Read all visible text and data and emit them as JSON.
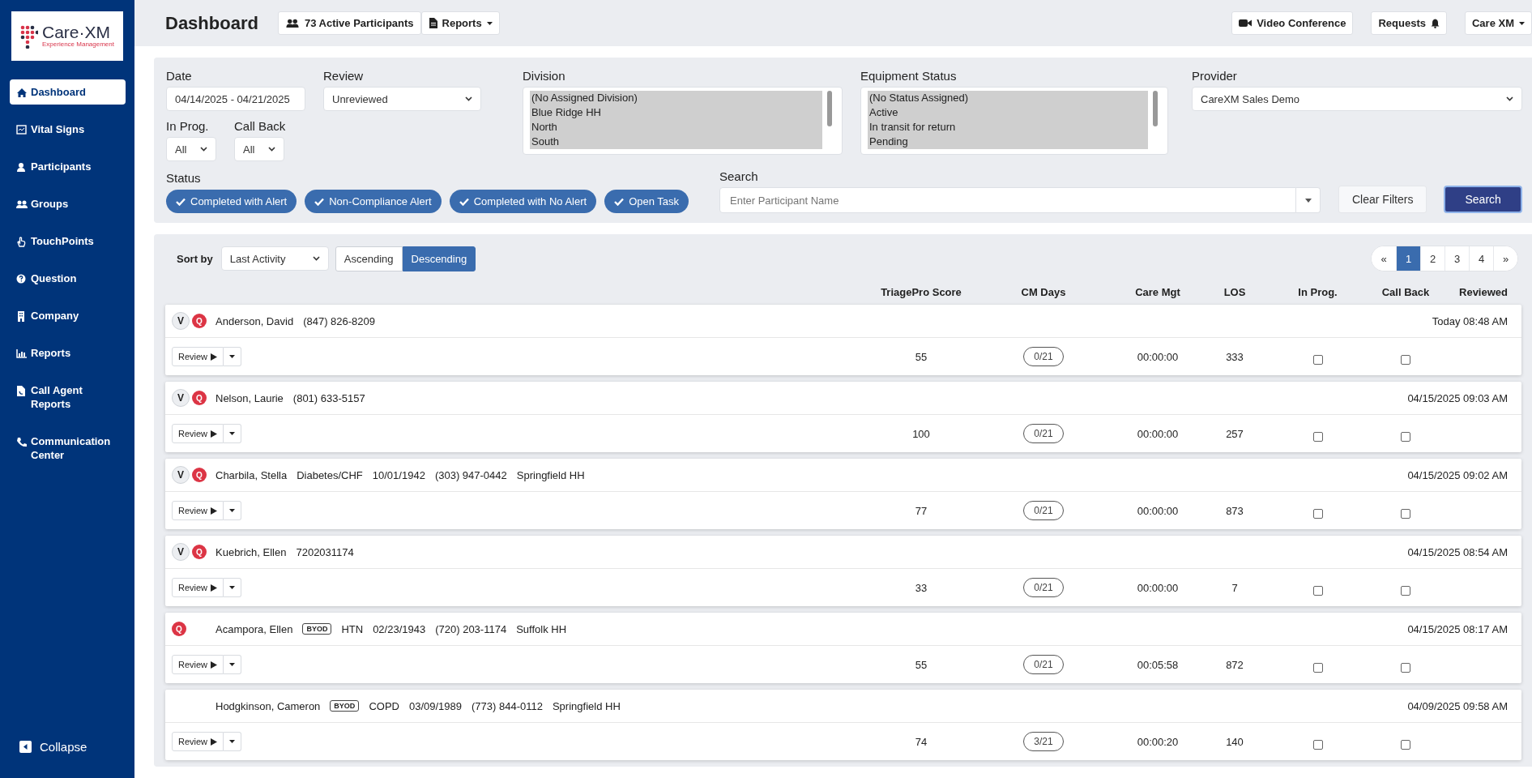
{
  "logo": {
    "brand": "Care·XM",
    "tagline": "Experience Management"
  },
  "sidebar": {
    "items": [
      {
        "label": "Dashboard",
        "selected": true
      },
      {
        "label": "Vital Signs",
        "selected": false
      },
      {
        "label": "Participants",
        "selected": false
      },
      {
        "label": "Groups",
        "selected": false
      },
      {
        "label": "TouchPoints",
        "selected": false
      },
      {
        "label": "Question",
        "selected": false
      },
      {
        "label": "Company",
        "selected": false
      },
      {
        "label": "Reports",
        "selected": false
      },
      {
        "label": "Call Agent Reports",
        "selected": false
      },
      {
        "label": "Communication Center",
        "selected": false
      }
    ],
    "collapse": "Collapse"
  },
  "header": {
    "title": "Dashboard",
    "participants_button": "73 Active Participants",
    "reports_button": "Reports",
    "video_button": "Video Conference",
    "requests_button": "Requests",
    "account_button": "Care XM"
  },
  "filters": {
    "date": {
      "label": "Date",
      "value": "04/14/2025 - 04/21/2025"
    },
    "review": {
      "label": "Review",
      "value": "Unreviewed"
    },
    "in_prog": {
      "label": "In Prog.",
      "value": "All"
    },
    "call_back": {
      "label": "Call Back",
      "value": "All"
    },
    "division": {
      "label": "Division",
      "options": [
        {
          "label": "(No Assigned Division)",
          "selected": true
        },
        {
          "label": "Blue Ridge HH",
          "selected": true
        },
        {
          "label": "North",
          "selected": true
        },
        {
          "label": "South",
          "selected": true
        }
      ]
    },
    "equipment_status": {
      "label": "Equipment Status",
      "options": [
        {
          "label": "(No Status Assigned)",
          "selected": true
        },
        {
          "label": "Active",
          "selected": true
        },
        {
          "label": "In transit for return",
          "selected": true
        },
        {
          "label": "Pending",
          "selected": true
        }
      ]
    },
    "provider": {
      "label": "Provider",
      "value": "CareXM Sales Demo"
    },
    "status": {
      "label": "Status",
      "chips": [
        {
          "label": "Completed with Alert",
          "checked": true
        },
        {
          "label": "Non-Compliance Alert",
          "checked": true
        },
        {
          "label": "Completed with No Alert",
          "checked": true
        },
        {
          "label": "Open Task",
          "checked": true
        }
      ]
    },
    "search": {
      "label": "Search",
      "placeholder": "Enter Participant Name"
    },
    "clear_button": "Clear Filters",
    "search_button": "Search"
  },
  "list": {
    "sort_label": "Sort by",
    "sort_value": "Last Activity",
    "order": [
      {
        "label": "Ascending",
        "selected": false
      },
      {
        "label": "Descending",
        "selected": true
      }
    ],
    "pagination": [
      {
        "label": "«",
        "selected": false
      },
      {
        "label": "1",
        "selected": true
      },
      {
        "label": "2",
        "selected": false
      },
      {
        "label": "3",
        "selected": false
      },
      {
        "label": "4",
        "selected": false
      },
      {
        "label": "»",
        "selected": false
      }
    ],
    "columns": [
      "TriagePro Score",
      "CM Days",
      "Care Mgt",
      "LOS",
      "In Prog.",
      "Call Back",
      "Reviewed"
    ],
    "rows": [
      {
        "badges": [
          {
            "kind": "v",
            "label": "V"
          },
          {
            "kind": "q",
            "label": "Q"
          }
        ],
        "review_button": "Review",
        "name": "Anderson, David",
        "details": [
          "(847) 826-8209"
        ],
        "reviewed": "Today 08:48 AM",
        "score": "55",
        "cm_days": "0/21",
        "care_mgt": "00:00:00",
        "los": "333",
        "in_prog": false,
        "call_back": false
      },
      {
        "badges": [
          {
            "kind": "v",
            "label": "V"
          },
          {
            "kind": "q",
            "label": "Q"
          }
        ],
        "review_button": "Review",
        "name": "Nelson, Laurie",
        "details": [
          "(801) 633-5157"
        ],
        "reviewed": "04/15/2025 09:03 AM",
        "score": "100",
        "cm_days": "0/21",
        "care_mgt": "00:00:00",
        "los": "257",
        "in_prog": false,
        "call_back": false
      },
      {
        "badges": [
          {
            "kind": "v",
            "label": "V"
          },
          {
            "kind": "q",
            "label": "Q"
          }
        ],
        "review_button": "Review",
        "name": "Charbila, Stella",
        "details": [
          "Diabetes/CHF",
          "10/01/1942",
          "(303) 947-0442",
          "Springfield HH"
        ],
        "reviewed": "04/15/2025 09:02 AM",
        "score": "77",
        "cm_days": "0/21",
        "care_mgt": "00:00:00",
        "los": "873",
        "in_prog": false,
        "call_back": false
      },
      {
        "badges": [
          {
            "kind": "v",
            "label": "V"
          },
          {
            "kind": "q",
            "label": "Q"
          }
        ],
        "review_button": "Review",
        "name": "Kuebrich, Ellen",
        "details": [
          "7202031174"
        ],
        "reviewed": "04/15/2025 08:54 AM",
        "score": "33",
        "cm_days": "0/21",
        "care_mgt": "00:00:00",
        "los": "7",
        "in_prog": false,
        "call_back": false
      },
      {
        "badges": [
          {
            "kind": "q",
            "label": "Q"
          }
        ],
        "review_button": "Review",
        "name": "Acampora, Ellen",
        "tag": "BYOD",
        "details": [
          "HTN",
          "02/23/1943",
          "(720) 203-1174",
          "Suffolk HH"
        ],
        "reviewed": "04/15/2025 08:17 AM",
        "score": "55",
        "cm_days": "0/21",
        "care_mgt": "00:05:58",
        "los": "872",
        "in_prog": false,
        "call_back": false
      },
      {
        "badges": [],
        "review_button": "Review",
        "name": "Hodgkinson, Cameron",
        "tag": "BYOD",
        "details": [
          "COPD",
          "03/09/1989",
          "(773) 844-0112",
          "Springfield HH"
        ],
        "reviewed": "04/09/2025 09:58 AM",
        "score": "74",
        "cm_days": "3/21",
        "care_mgt": "00:00:20",
        "los": "140",
        "in_prog": false,
        "call_back": false
      }
    ]
  }
}
